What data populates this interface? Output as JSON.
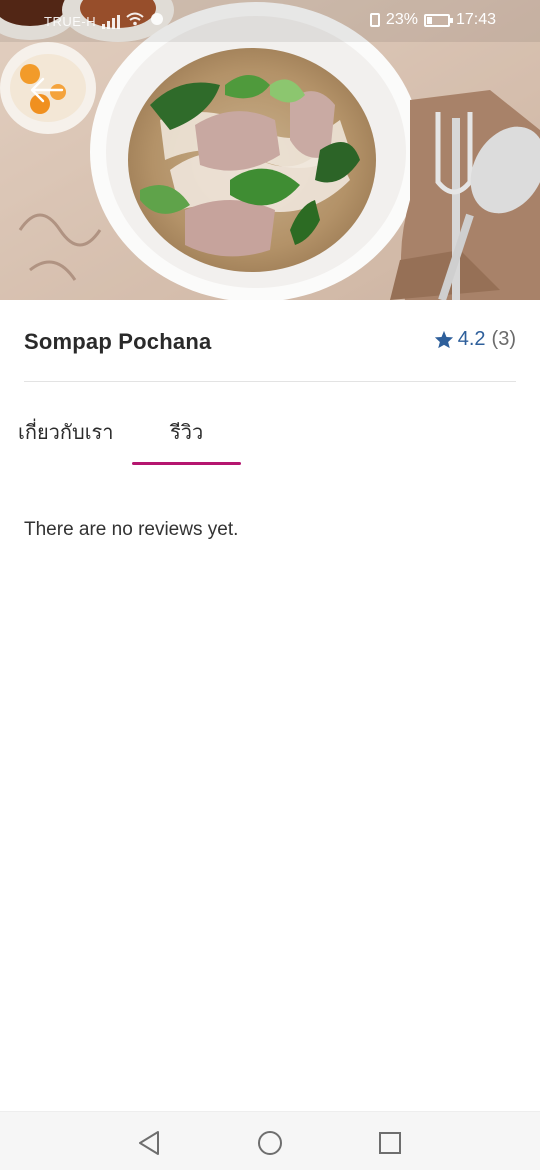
{
  "status_bar": {
    "carrier": "TRUE-H",
    "battery": "23%",
    "time": "17:43"
  },
  "restaurant": {
    "name": "Sompap Pochana",
    "rating": "4.2",
    "review_count": "(3)"
  },
  "tabs": [
    {
      "label": "เกี่ยวกับเรา",
      "active": false
    },
    {
      "label": "รีวิว",
      "active": true
    }
  ],
  "reviews": {
    "empty_message": "There are no reviews yet."
  },
  "colors": {
    "accent": "#b5166f",
    "rating_blue": "#2e5f9b"
  }
}
